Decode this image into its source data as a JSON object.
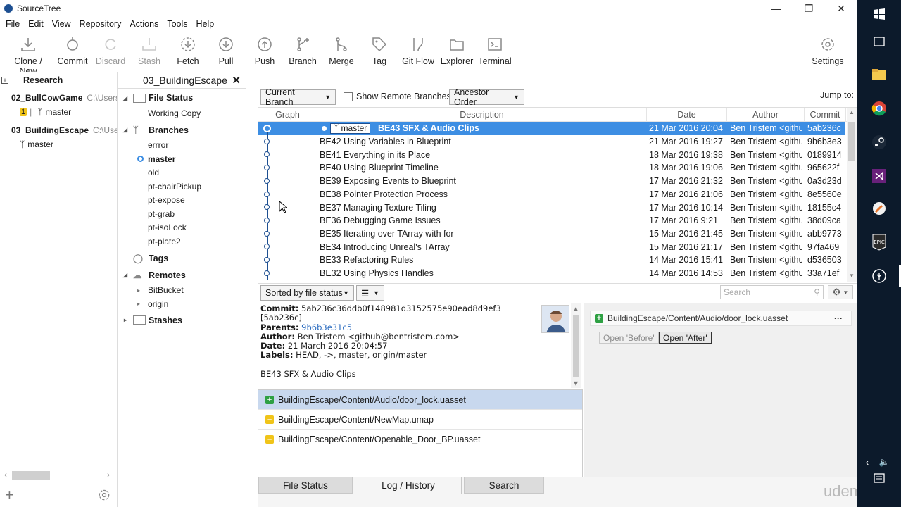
{
  "app": {
    "title": "SourceTree"
  },
  "menu": [
    "File",
    "Edit",
    "View",
    "Repository",
    "Actions",
    "Tools",
    "Help"
  ],
  "toolbar": {
    "clone": "Clone / New",
    "commit": "Commit",
    "discard": "Discard",
    "stash": "Stash",
    "fetch": "Fetch",
    "pull": "Pull",
    "push": "Push",
    "branch": "Branch",
    "merge": "Merge",
    "tag": "Tag",
    "gitflow": "Git Flow",
    "explorer": "Explorer",
    "terminal": "Terminal",
    "settings": "Settings"
  },
  "repos": {
    "group": "Research",
    "items": [
      {
        "name": "02_BullCowGame",
        "path": "C:\\Users\\",
        "badge": "1",
        "branch": "master"
      },
      {
        "name": "03_BuildingEscape",
        "path": "C:\\User",
        "branch": "master"
      }
    ]
  },
  "tab": {
    "label": "03_BuildingEscape"
  },
  "sidebar": {
    "file_status": "File Status",
    "working_copy": "Working Copy",
    "branches": "Branches",
    "branch_list": [
      "errror",
      "master",
      "old",
      "pt-chairPickup",
      "pt-expose",
      "pt-grab",
      "pt-isoLock",
      "pt-plate2"
    ],
    "tags": "Tags",
    "remotes": "Remotes",
    "remote_list": [
      "BitBucket",
      "origin"
    ],
    "stashes": "Stashes"
  },
  "filters": {
    "branch": "Current Branch",
    "show_remote": "Show Remote Branches",
    "order": "Ancestor Order",
    "jump_to": "Jump to:"
  },
  "columns": {
    "graph": "Graph",
    "description": "Description",
    "date": "Date",
    "author": "Author",
    "commit": "Commit"
  },
  "commits": [
    {
      "desc": "BE43 SFX & Audio Clips",
      "branch_tag": "master",
      "date": "21 Mar 2016 20:04",
      "author": "Ben Tristem <githu",
      "hash": "5ab236c"
    },
    {
      "desc": "BE42 Using Variables in Blueprint",
      "date": "21 Mar 2016 19:27",
      "author": "Ben Tristem <githu",
      "hash": "9b6b3e3"
    },
    {
      "desc": "BE41 Everything in its Place",
      "date": "18 Mar 2016 19:38",
      "author": "Ben Tristem <githu",
      "hash": "0189914"
    },
    {
      "desc": "BE40 Using Blueprint Timeline",
      "date": "18 Mar 2016 19:06",
      "author": "Ben Tristem <githu",
      "hash": "965622f"
    },
    {
      "desc": "BE39 Exposing Events to Blueprint",
      "date": "17 Mar 2016 21:32",
      "author": "Ben Tristem <githu",
      "hash": "0a3d23d"
    },
    {
      "desc": "BE38 Pointer Protection Process",
      "date": "17 Mar 2016 21:06",
      "author": "Ben Tristem <githu",
      "hash": "8e5560e"
    },
    {
      "desc": "BE37 Managing Texture Tiling",
      "date": "17 Mar 2016 10:14",
      "author": "Ben Tristem <githu",
      "hash": "18155c4"
    },
    {
      "desc": "BE36 Debugging Game Issues",
      "date": "17 Mar 2016 9:21",
      "author": "Ben Tristem <githu",
      "hash": "38d09ca"
    },
    {
      "desc": "BE35 Iterating over TArray with for",
      "date": "15 Mar 2016 21:45",
      "author": "Ben Tristem <githu",
      "hash": "abb9773"
    },
    {
      "desc": "BE34 Introducing Unreal's TArray",
      "date": "15 Mar 2016 21:17",
      "author": "Ben Tristem <githu",
      "hash": "97fa469"
    },
    {
      "desc": "BE33 Refactoring Rules",
      "date": "14 Mar 2016 15:41",
      "author": "Ben Tristem <githu",
      "hash": "d536503"
    },
    {
      "desc": "BE32 Using Physics Handles",
      "date": "14 Mar 2016 14:53",
      "author": "Ben Tristem <githu",
      "hash": "33a71ef"
    }
  ],
  "lower": {
    "sort": "Sorted by file status",
    "search_placeholder": "Search"
  },
  "details": {
    "commit_label": "Commit:",
    "commit_full": "5ab236c36ddb0f148981d3152575e90ead8d9ef3",
    "commit_short": "[5ab236c]",
    "parents_label": "Parents:",
    "parents": "9b6b3e31c5",
    "author_label": "Author:",
    "author": "Ben Tristem <github@bentristem.com>",
    "date_label": "Date:",
    "date": "21 March 2016 20:04:57",
    "labels_label": "Labels:",
    "labels": "HEAD, ->, master, origin/master",
    "message": "BE43 SFX & Audio Clips"
  },
  "files": [
    {
      "path": "BuildingEscape/Content/Audio/door_lock.uasset",
      "status": "added"
    },
    {
      "path": "BuildingEscape/Content/NewMap.umap",
      "status": "modified"
    },
    {
      "path": "BuildingEscape/Content/Openable_Door_BP.uasset",
      "status": "modified"
    }
  ],
  "diff": {
    "file": "BuildingEscape/Content/Audio/door_lock.uasset",
    "open_before": "Open 'Before'",
    "open_after": "Open 'After'",
    "more": "···"
  },
  "bottom_tabs": {
    "file_status": "File Status",
    "log": "Log / History",
    "search": "Search"
  },
  "watermark": "udemy",
  "colors": {
    "selection": "#3d8ee3",
    "added": "#2ea043",
    "modified": "#f0c419",
    "graph": "#1d4f91"
  }
}
